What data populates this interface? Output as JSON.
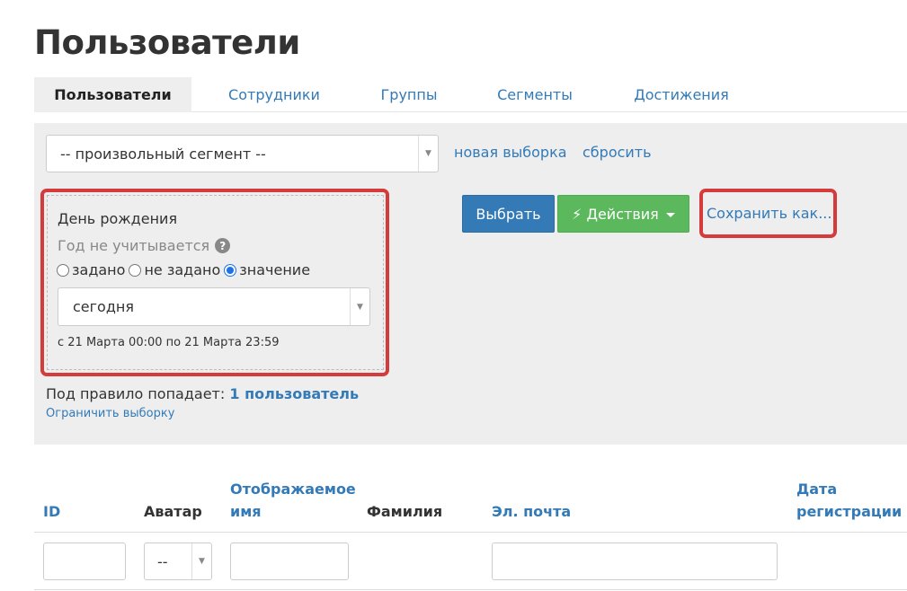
{
  "page": {
    "title": "Пользователи"
  },
  "tabs": [
    {
      "label": "Пользователи",
      "active": true
    },
    {
      "label": "Сотрудники",
      "active": false
    },
    {
      "label": "Группы",
      "active": false
    },
    {
      "label": "Сегменты",
      "active": false
    },
    {
      "label": "Достижения",
      "active": false
    }
  ],
  "filter": {
    "segment_select": {
      "value": "-- произвольный сегмент --"
    },
    "new_selection_link": "новая выборка",
    "reset_link": "сбросить",
    "birthday": {
      "title": "День рождения",
      "hint": "Год не учитывается",
      "help_icon": "?",
      "radio_options": [
        {
          "label": "задано",
          "checked": false
        },
        {
          "label": "не задано",
          "checked": false
        },
        {
          "label": "значение",
          "checked": true
        }
      ],
      "period_select": {
        "value": "сегодня"
      },
      "range_text": "с 21 Марта 00:00 по 21 Марта 23:59"
    },
    "buttons": {
      "select_label": "Выбрать",
      "actions_icon": "⚡",
      "actions_label": "Действия",
      "save_as_label": "Сохранить как..."
    },
    "matches": {
      "prefix": "Под правило попадает:",
      "count_text": "1 пользователь"
    },
    "limit_link": "Ограничить выборку"
  },
  "table": {
    "columns": [
      {
        "line1": "",
        "line2": "ID"
      },
      {
        "line1": "",
        "line2": "Аватар"
      },
      {
        "line1": "Отображаемое",
        "line2": "имя"
      },
      {
        "line1": "",
        "line2": "Фамилия"
      },
      {
        "line1": "",
        "line2": "Эл. почта"
      },
      {
        "line1": "Дата",
        "line2": "регистрации"
      }
    ],
    "avatar_filter": {
      "value": "--"
    }
  }
}
